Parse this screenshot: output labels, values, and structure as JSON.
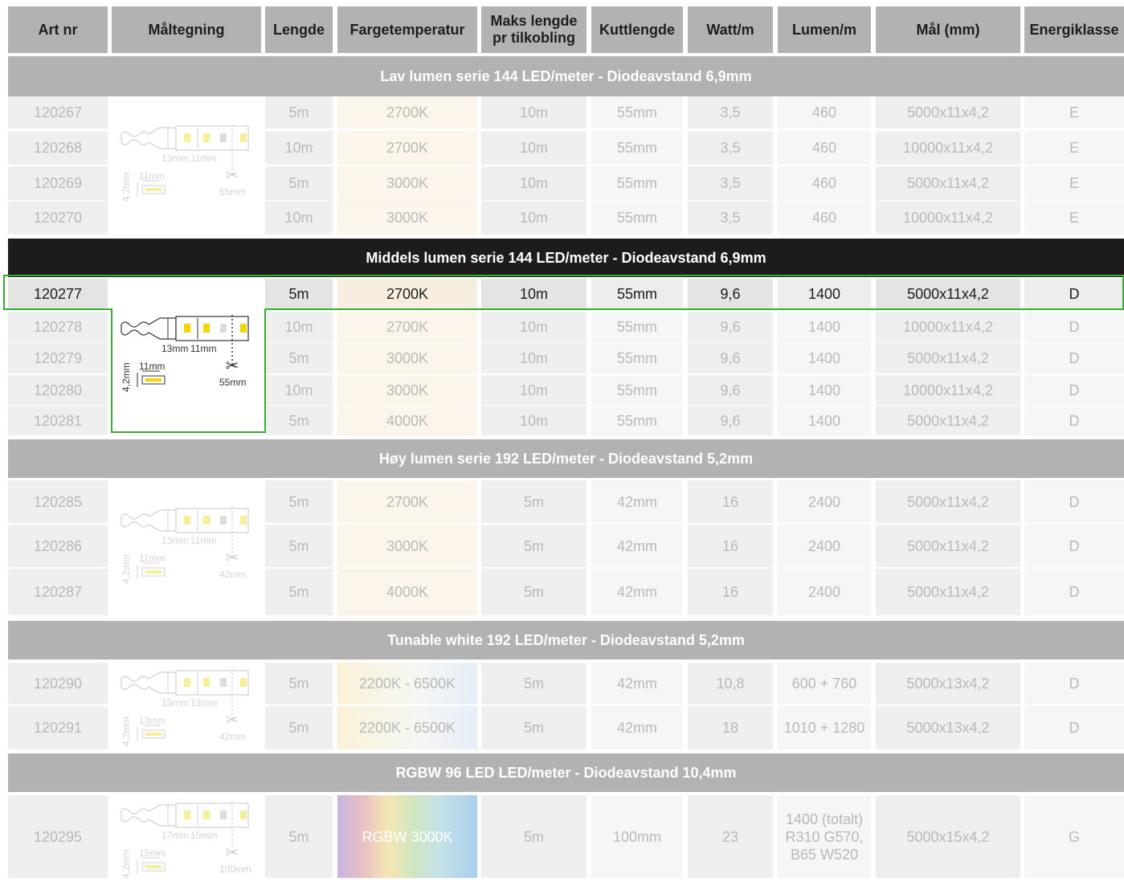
{
  "headers": [
    "Art nr",
    "Måltegning",
    "Lengde",
    "Fargetemperatur",
    "Maks lengde pr tilkobling",
    "Kuttlengde",
    "Watt/m",
    "Lumen/m",
    "Mål (mm)",
    "Energiklasse"
  ],
  "sections": [
    {
      "title": "Lav lumen serie 144 LED/meter - Diodeavstand 6,9mm",
      "style": "grey",
      "rows": [
        [
          "120267",
          "5m",
          "2700K",
          "10m",
          "55mm",
          "3,5",
          "460",
          "5000x11x4,2",
          "E"
        ],
        [
          "120268",
          "10m",
          "2700K",
          "10m",
          "55mm",
          "3,5",
          "460",
          "10000x11x4,2",
          "E"
        ],
        [
          "120269",
          "5m",
          "3000K",
          "10m",
          "55mm",
          "3,5",
          "460",
          "5000x11x4,2",
          "E"
        ],
        [
          "120270",
          "10m",
          "3000K",
          "10m",
          "55mm",
          "3,5",
          "460",
          "10000x11x4,2",
          "E"
        ]
      ]
    },
    {
      "title": "Middels lumen serie 144 LED/meter - Diodeavstand 6,9mm",
      "style": "dark",
      "rows": [
        [
          "120277",
          "5m",
          "2700K",
          "10m",
          "55mm",
          "9,6",
          "1400",
          "5000x11x4,2",
          "D"
        ],
        [
          "120278",
          "10m",
          "2700K",
          "10m",
          "55mm",
          "9,6",
          "1400",
          "10000x11x4,2",
          "D"
        ],
        [
          "120279",
          "5m",
          "3000K",
          "10m",
          "55mm",
          "9,6",
          "1400",
          "5000x11x4,2",
          "D"
        ],
        [
          "120280",
          "10m",
          "3000K",
          "10m",
          "55mm",
          "9,6",
          "1400",
          "10000x11x4,2",
          "D"
        ],
        [
          "120281",
          "5m",
          "4000K",
          "10m",
          "55mm",
          "9,6",
          "1400",
          "5000x11x4,2",
          "D"
        ]
      ]
    },
    {
      "title": "Høy lumen serie 192 LED/meter - Diodeavstand 5,2mm",
      "style": "grey",
      "rows": [
        [
          "120285",
          "5m",
          "2700K",
          "5m",
          "42mm",
          "16",
          "2400",
          "5000x11x4,2",
          "D"
        ],
        [
          "120286",
          "5m",
          "3000K",
          "5m",
          "42mm",
          "16",
          "2400",
          "5000x11x4,2",
          "D"
        ],
        [
          "120287",
          "5m",
          "4000K",
          "5m",
          "42mm",
          "16",
          "2400",
          "5000x11x4,2",
          "D"
        ]
      ]
    },
    {
      "title": "Tunable white 192 LED/meter - Diodeavstand 5,2mm",
      "style": "grey",
      "rows": [
        [
          "120290",
          "5m",
          "2200K - 6500K",
          "5m",
          "42mm",
          "10,8",
          "600 + 760",
          "5000x13x4,2",
          "D"
        ],
        [
          "120291",
          "5m",
          "2200K - 6500K",
          "5m",
          "42mm",
          "18",
          "1010 + 1280",
          "5000x13x4,2",
          "D"
        ]
      ]
    },
    {
      "title": "RGBW 96 LED LED/meter  - Diodeavstand 10,4mm",
      "style": "grey",
      "rows": [
        [
          "120295",
          "5m",
          "RGBW 3000K",
          "5m",
          "100mm",
          "23",
          "1400 (totalt) R310 G570, B65 W520",
          "5000x15x4,2",
          "G"
        ]
      ]
    }
  ],
  "drawings": [
    {
      "a": "13mm",
      "b": "11mm",
      "w": "11mm",
      "h": "4,2mm",
      "cut": "55mm"
    },
    {
      "a": "13mm",
      "b": "11mm",
      "w": "11mm",
      "h": "4,2mm",
      "cut": "55mm"
    },
    {
      "a": "13mm",
      "b": "11mm",
      "w": "11mm",
      "h": "4,2mm",
      "cut": "42mm"
    },
    {
      "a": "15mm",
      "b": "13mm",
      "w": "13mm",
      "h": "4,2mm",
      "cut": "42mm"
    },
    {
      "a": "17mm",
      "b": "15mm",
      "w": "15mm",
      "h": "4,2mm",
      "cut": "100mm"
    }
  ],
  "highlight": {
    "row": "120277",
    "color": "#3aaa35"
  },
  "colors": {
    "header_bg": "#b2b2b2",
    "dark_band": "#1d1c1b",
    "faded_text": "#b9b9b9"
  }
}
